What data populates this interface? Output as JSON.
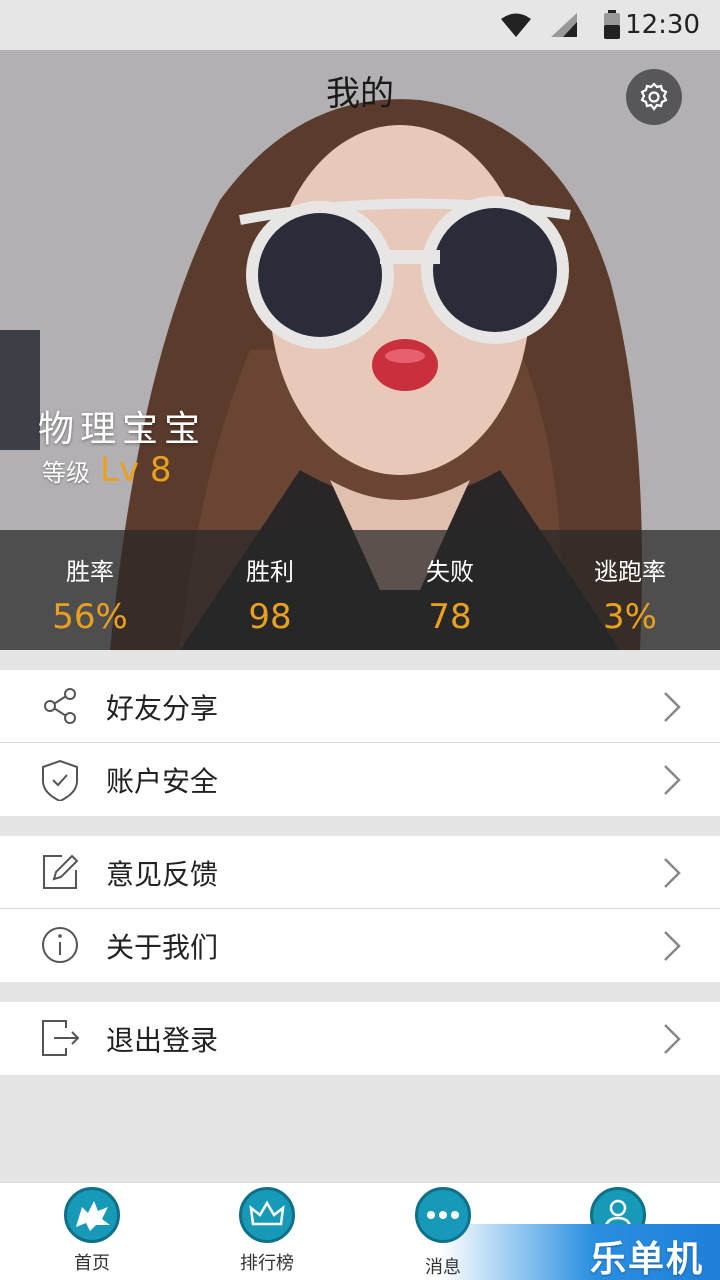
{
  "status_bar": {
    "time": "12:30"
  },
  "header": {
    "title": "我的"
  },
  "profile": {
    "name": "物理宝宝",
    "level_label": "等级",
    "level_value": "Lv 8"
  },
  "stats": [
    {
      "label": "胜率",
      "value": "56%"
    },
    {
      "label": "胜利",
      "value": "98"
    },
    {
      "label": "失败",
      "value": "78"
    },
    {
      "label": "逃跑率",
      "value": "3%"
    }
  ],
  "menu": {
    "share": "好友分享",
    "security": "账户安全",
    "feedback": "意见反馈",
    "about": "关于我们",
    "logout": "退出登录"
  },
  "bottom_nav": {
    "home": "首页",
    "ranking": "排行榜",
    "messages": "消息"
  },
  "watermark": "乐单机",
  "colors": {
    "accent": "#e9a020",
    "nav_blue": "#1799b8"
  }
}
